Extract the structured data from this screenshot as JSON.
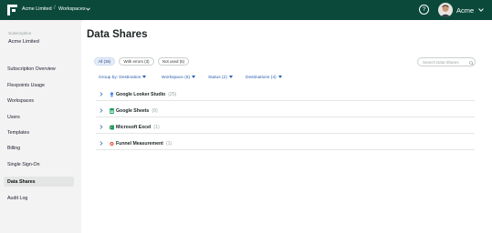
{
  "header": {
    "org_name": "Acme Limited",
    "separator": "/",
    "section": "Workspaces",
    "help_symbol": "?",
    "user_name": "Acme",
    "colors": {
      "topbar": "#0b4a3a"
    }
  },
  "sidebar": {
    "subscription_label": "Subscription",
    "subscription_value": "Acme Limited",
    "items": [
      {
        "label": "Subscription Overview",
        "active": false
      },
      {
        "label": "Flexpoints Usage",
        "active": false
      },
      {
        "label": "Workspaces",
        "active": false
      },
      {
        "label": "Users",
        "active": false
      },
      {
        "label": "Templates",
        "active": false
      },
      {
        "label": "Billing",
        "active": false
      },
      {
        "label": "Single Sign-On",
        "active": false
      },
      {
        "label": "Data Shares",
        "active": true
      },
      {
        "label": "Audit Log",
        "active": false
      }
    ]
  },
  "main": {
    "title": "Data Shares",
    "pills": [
      {
        "label": "All (35)",
        "active": true
      },
      {
        "label": "With errors (3)",
        "active": false
      },
      {
        "label": "Not used (5)",
        "active": false
      }
    ],
    "search_placeholder": "Search Data Shares",
    "filters": [
      {
        "label": "Group by: Destination"
      },
      {
        "label": "Workspace (6)"
      },
      {
        "label": "Status (2)"
      },
      {
        "label": "Destinations (4)"
      }
    ],
    "rows": [
      {
        "name": "Google Looker Studio",
        "count": "(25)",
        "icon": "looker-studio-icon",
        "color": "#4285f4"
      },
      {
        "name": "Google Sheets",
        "count": "(9)",
        "icon": "google-sheets-icon",
        "color": "#0f9d58"
      },
      {
        "name": "Microsoft Excel",
        "count": "(1)",
        "icon": "microsoft-excel-icon",
        "color": "#1d6f42"
      },
      {
        "name": "Funnel Measurement",
        "count": "(1)",
        "icon": "funnel-measurement-icon",
        "color": "#e8553f"
      }
    ],
    "colors": {
      "link": "#2b5fae",
      "pill_active_bg": "#e4edf9"
    }
  }
}
